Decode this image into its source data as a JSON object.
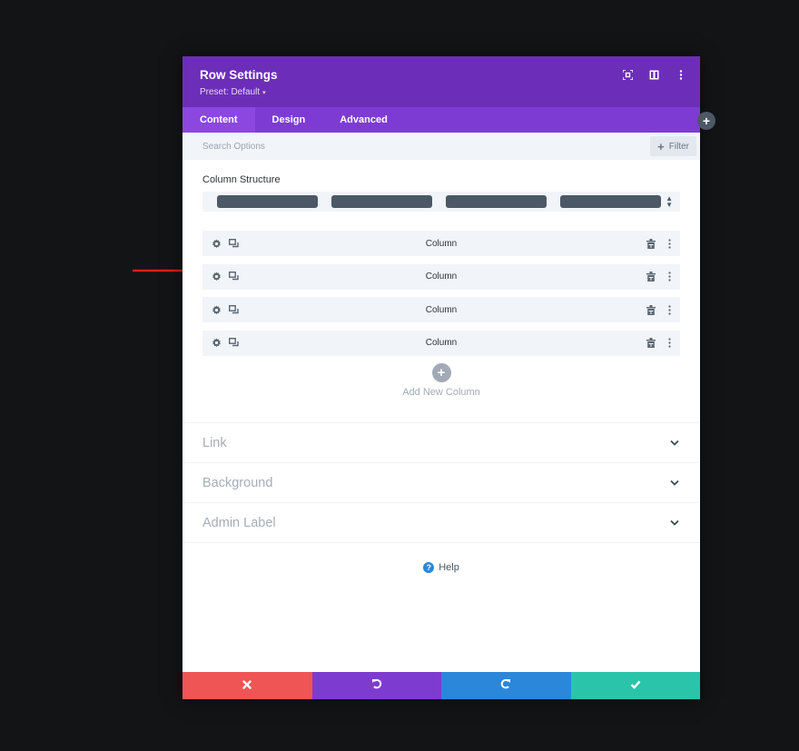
{
  "modal": {
    "title": "Row Settings",
    "preset_label": "Preset: Default",
    "header_icons": [
      "expand-icon",
      "sidebar-layout-icon",
      "more-options-icon"
    ]
  },
  "tabs": [
    {
      "label": "Content",
      "active": true
    },
    {
      "label": "Design",
      "active": false
    },
    {
      "label": "Advanced",
      "active": false
    }
  ],
  "search": {
    "placeholder": "Search Options",
    "filter_label": "Filter"
  },
  "column_structure": {
    "label": "Column Structure",
    "selected_columns": 4
  },
  "columns": [
    {
      "label": "Column"
    },
    {
      "label": "Column"
    },
    {
      "label": "Column"
    },
    {
      "label": "Column"
    }
  ],
  "add_column": {
    "label": "Add New Column"
  },
  "toggles": [
    {
      "label": "Link"
    },
    {
      "label": "Background"
    },
    {
      "label": "Admin Label"
    }
  ],
  "help": {
    "label": "Help"
  },
  "footer": {
    "buttons": [
      {
        "name": "cancel",
        "icon": "close-icon",
        "color": "#ef5555"
      },
      {
        "name": "undo",
        "icon": "undo-icon",
        "color": "#7e3bd0"
      },
      {
        "name": "redo",
        "icon": "redo-icon",
        "color": "#2b87da"
      },
      {
        "name": "save",
        "icon": "check-icon",
        "color": "#29c4a9"
      }
    ]
  },
  "colors": {
    "header": "#6c2eb9",
    "tabs": "#7d3bd4",
    "annotation_arrow": "#d81f1f"
  }
}
